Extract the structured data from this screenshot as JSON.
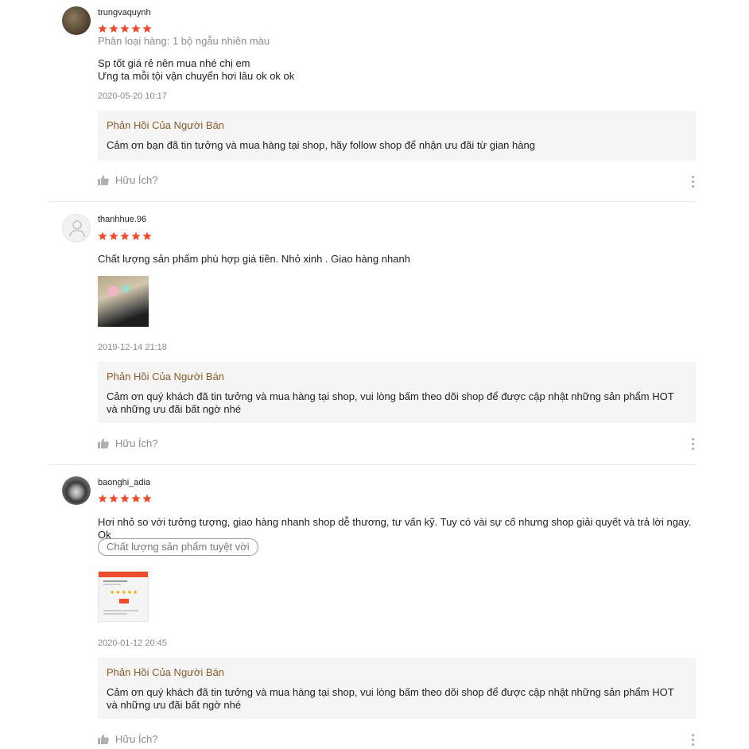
{
  "reviews": [
    {
      "username": "trungvaquynh",
      "rating": 5,
      "variant": "Phân loại hàng: 1 bộ ngẫu nhiên màu",
      "content": "Sp tốt giá rẻ nên mua nhé chị em\nƯng ta mỗi tội vận chuyển hơi lâu ok ok ok",
      "date": "2020-05-20 10:17",
      "reply_title": "Phản Hồi Của Người Bán",
      "reply_text": "Cảm ơn bạn đã tin tưởng và mua hàng tại shop, hãy follow shop để nhận ưu đãi từ gian hàng",
      "helpful_label": "Hữu Ích?"
    },
    {
      "username": "thanhhue.96",
      "rating": 5,
      "content": "Chất lượng sản phẩm phù hợp giá tiền. Nhỏ xinh . Giao hàng nhanh",
      "date": "2019-12-14 21:18",
      "reply_title": "Phản Hồi Của Người Bán",
      "reply_text": "Cảm ơn quý khách đã tin tưởng và mua hàng tại shop, vui lòng bấm theo dõi shop để được cập nhật những sản phẩm HOT và những ưu đãi bất ngờ nhé",
      "helpful_label": "Hữu Ích?"
    },
    {
      "username": "baonghi_adia",
      "rating": 5,
      "content": "Hơi nhỏ so với tưởng tượng, giao hàng nhanh shop dễ thương, tư vấn kỹ. Tuy có vài sự cố nhưng shop giải quyết và trả lời ngay. Ok",
      "tag": "Chất lượng sản phẩm tuyệt vời",
      "date": "2020-01-12 20:45",
      "reply_title": "Phản Hồi Của Người Bán",
      "reply_text": "Cảm ơn quý khách đã tin tưởng và mua hàng tại shop, vui lòng bấm theo dõi shop để được cập nhật những sản phẩm HOT và những ưu đãi bất ngờ nhé",
      "helpful_label": "Hữu Ích?"
    }
  ],
  "colors": {
    "star": "#ee4d2d",
    "reply_title": "#8b5a2b",
    "reply_bg": "#f5f5f5"
  }
}
